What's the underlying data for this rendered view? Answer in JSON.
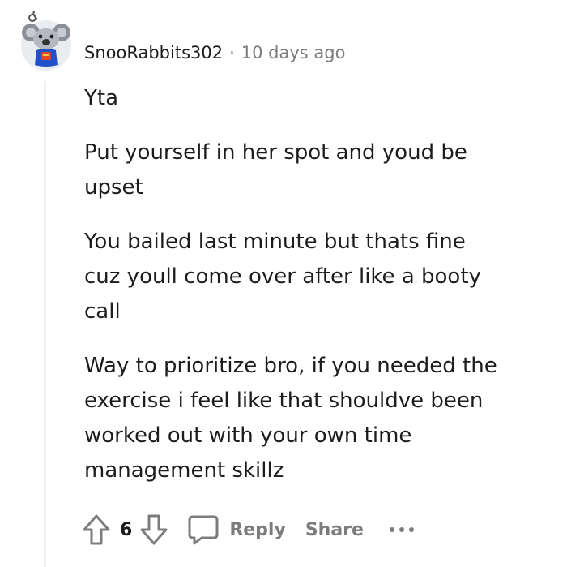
{
  "comment": {
    "username": "SnooRabbits302",
    "separator": "·",
    "timestamp": "10 days ago",
    "paragraphs": [
      "Yta",
      "Put yourself in her spot and youd be upset",
      "You bailed last minute but thats fine cuz youll come over after like a booty call",
      "Way to prioritize bro, if you needed the exercise i feel like that shouldve been worked out with your own time management skillz"
    ]
  },
  "actions": {
    "upvote_icon": "arrow-up-icon",
    "vote_count": "6",
    "downvote_icon": "arrow-down-icon",
    "reply_icon": "speech-bubble-icon",
    "reply_label": "Reply",
    "share_label": "Share",
    "more_icon": "more-horizontal-icon"
  },
  "colors": {
    "text": "#1c1c1c",
    "muted": "#7c7c7c",
    "thread_line": "#edeff1",
    "avatar_shirt": "#2150c8",
    "avatar_accent": "#e4462a"
  }
}
